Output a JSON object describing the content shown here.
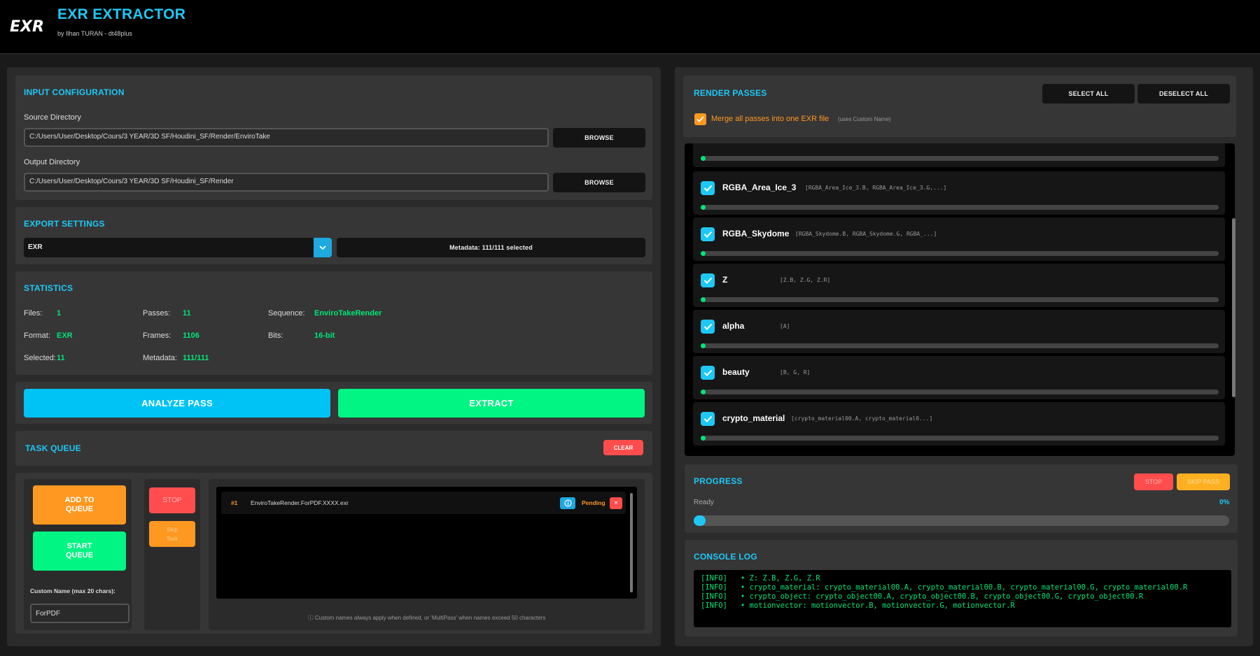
{
  "app": {
    "title": "EXR EXTRACTOR",
    "subtitle": "by Ilhan TURAN - dt48plus"
  },
  "input_config": {
    "title": "INPUT CONFIGURATION",
    "source_label": "Source Directory",
    "source_value": "C:/Users/User/Desktop/Cours/3 YEAR/3D SF/Houdini_SF/Render/EnviroTake",
    "output_label": "Output Directory",
    "output_value": "C:/Users/User/Desktop/Cours/3 YEAR/3D SF/Houdini_SF/Render",
    "browse_label": "BROWSE"
  },
  "export_settings": {
    "title": "EXPORT SETTINGS",
    "format": "EXR",
    "metadata_button": "Metadata: 111/111 selected"
  },
  "statistics": {
    "title": "STATISTICS",
    "files_label": "Files:",
    "files_value": "1",
    "passes_label": "Passes:",
    "passes_value": "11",
    "sequence_label": "Sequence:",
    "sequence_value": "EnviroTakeRender",
    "format_label": "Format:",
    "format_value": "EXR",
    "frames_label": "Frames:",
    "frames_value": "1106",
    "bits_label": "Bits:",
    "bits_value": "16-bit",
    "selected_label": "Selected:",
    "selected_value": "11",
    "metadata_label": "Metadata:",
    "metadata_value": "111/111"
  },
  "actions": {
    "analyze": "ANALYZE PASS",
    "extract": "EXTRACT"
  },
  "task_queue": {
    "title": "TASK QUEUE",
    "clear": "CLEAR",
    "add": "ADD TO QUEUE",
    "start": "START QUEUE",
    "stop": "STOP",
    "skip": "Skip Task",
    "custom_name_label": "Custom Name (max 20 chars):",
    "custom_name_value": "ForPDF",
    "task": {
      "index": "#1",
      "name": "EnviroTakeRender.ForPDF.XXXX.exr",
      "status": "Pending",
      "remove": "×"
    },
    "note": "ⓘ Custom names always apply when defined, or 'MultiPass' when names exceed 50 characters"
  },
  "render_passes": {
    "title": "RENDER PASSES",
    "select_all": "SELECT ALL",
    "deselect_all": "DESELECT ALL",
    "merge_label": "Merge all passes into one EXR file",
    "merge_hint": "(uses Custom Name)",
    "merge_checked": true,
    "items": [
      {
        "name": "RGBA_Area_Ice_3",
        "channels": "[RGBA_Area_Ice_3.B, RGBA_Area_Ice_3.G,...]",
        "progress": 0
      },
      {
        "name": "RGBA_Skydome",
        "channels": "[RGBA_Skydome.B, RGBA_Skydome.G, RGBA_...]",
        "progress": 0
      },
      {
        "name": "Z",
        "channels": "[Z.B, Z.G, Z.R]",
        "progress": 0
      },
      {
        "name": "alpha",
        "channels": "[A]",
        "progress": 0
      },
      {
        "name": "beauty",
        "channels": "[B, G, R]",
        "progress": 0
      },
      {
        "name": "crypto_material",
        "channels": "[crypto_material00.A, crypto_material0...]",
        "progress": 0
      }
    ]
  },
  "progress": {
    "title": "PROGRESS",
    "stop": "STOP",
    "skip": "SKIP PASS",
    "status": "Ready",
    "percent": "0%",
    "value": 0
  },
  "console": {
    "title": "CONSOLE LOG",
    "lines": [
      "[INFO]   • Z: Z.B, Z.G, Z.R",
      "[INFO]   • crypto_material: crypto_material00.A, crypto_material00.B, crypto_material00.G, crypto_material00.R",
      "[INFO]   • crypto_object: crypto_object00.A, crypto_object00.B, crypto_object00.G, crypto_object00.R",
      "[INFO]   • motionvector: motionvector.B, motionvector.G, motionvector.R"
    ]
  },
  "colors": {
    "accent": "#1ec8f5",
    "green": "#00e676",
    "orange": "#ff9800",
    "red": "#ff4d4d"
  }
}
